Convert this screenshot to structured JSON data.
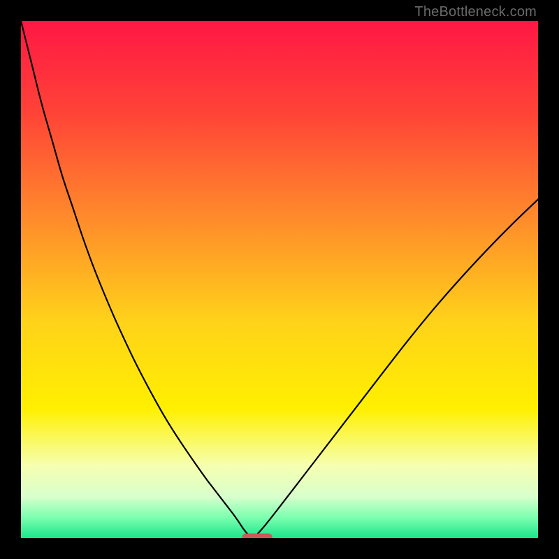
{
  "watermark": "TheBottleneck.com",
  "colors": {
    "bg_black": "#000000",
    "curve": "#000000",
    "marker": "#c85a5a",
    "gradient_stops": [
      {
        "pct": 0,
        "color": "#ff1744"
      },
      {
        "pct": 18,
        "color": "#ff4437"
      },
      {
        "pct": 38,
        "color": "#ff8a2b"
      },
      {
        "pct": 58,
        "color": "#ffd21a"
      },
      {
        "pct": 75,
        "color": "#fff000"
      },
      {
        "pct": 86,
        "color": "#f6ffb0"
      },
      {
        "pct": 92,
        "color": "#d8ffcc"
      },
      {
        "pct": 96,
        "color": "#7cffb0"
      },
      {
        "pct": 100,
        "color": "#1ae58a"
      }
    ]
  },
  "chart_data": {
    "type": "line",
    "title": "",
    "xlabel": "",
    "ylabel": "",
    "xlim": [
      0,
      100
    ],
    "ylim": [
      0,
      100
    ],
    "x": [
      0,
      2,
      4,
      6,
      8,
      10,
      12,
      14,
      16,
      18,
      20,
      22,
      24,
      26,
      28,
      30,
      32,
      34,
      36,
      37,
      38,
      39,
      40,
      41,
      42,
      43,
      44,
      45,
      47,
      50,
      55,
      60,
      65,
      70,
      75,
      80,
      85,
      90,
      95,
      100
    ],
    "series": [
      {
        "name": "left",
        "values": [
          100,
          92,
          84,
          77,
          70,
          64,
          58,
          52.5,
          47.5,
          42.8,
          38.4,
          34.2,
          30.3,
          26.6,
          23.1,
          19.9,
          16.9,
          14.0,
          11.2,
          9.9,
          8.6,
          7.3,
          6.0,
          4.7,
          3.3,
          1.8,
          0.6,
          0,
          null,
          null,
          null,
          null,
          null,
          null,
          null,
          null,
          null,
          null,
          null,
          null
        ]
      },
      {
        "name": "right",
        "values": [
          null,
          null,
          null,
          null,
          null,
          null,
          null,
          null,
          null,
          null,
          null,
          null,
          null,
          null,
          null,
          null,
          null,
          null,
          null,
          null,
          null,
          null,
          null,
          null,
          null,
          null,
          null,
          0,
          2.2,
          6.0,
          12.5,
          19.0,
          25.5,
          32.0,
          38.4,
          44.5,
          50.2,
          55.6,
          60.7,
          65.5
        ]
      }
    ],
    "annotations": [
      {
        "name": "min-marker",
        "shape": "rounded-rect",
        "x_range": [
          42.8,
          48.6
        ],
        "y": 0,
        "color": "#c85a5a"
      }
    ],
    "grid": false,
    "legend": false
  }
}
